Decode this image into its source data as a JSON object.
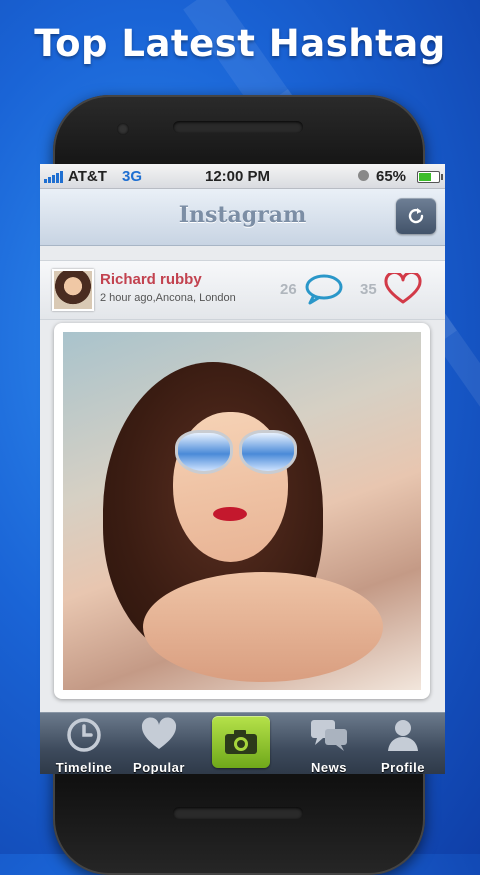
{
  "promo": {
    "headline": "Top Latest Hashtag"
  },
  "status_bar": {
    "carrier": "AT&T",
    "network": "3G",
    "time": "12:00 PM",
    "battery": "65%",
    "battery_level": 0.65,
    "icons": [
      "signal-bars-icon",
      "alarm-icon",
      "battery-icon"
    ]
  },
  "nav": {
    "title": "Instagram",
    "refresh_icon": "refresh-icon"
  },
  "post": {
    "username": "Richard rubby",
    "meta": "2 hour ago,Ancona, London",
    "comments": "26",
    "likes": "35",
    "icons": [
      "comment-bubble-icon",
      "heart-icon"
    ]
  },
  "tabs": [
    {
      "label": "Timeline",
      "icon": "clock-icon"
    },
    {
      "label": "Popular",
      "icon": "heart-icon"
    },
    {
      "label": "",
      "icon": "camera-icon"
    },
    {
      "label": "News",
      "icon": "chat-bubbles-icon"
    },
    {
      "label": "Profile",
      "icon": "person-icon"
    }
  ],
  "colors": {
    "background": "#1a64d6",
    "username": "#c2424f",
    "camera_tab": "#8cc620",
    "tabbar": "#3d4a5c"
  }
}
